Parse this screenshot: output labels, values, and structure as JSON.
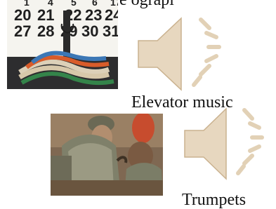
{
  "slide": {
    "top_text": "e ograpl",
    "items": [
      {
        "label": "Elevator music",
        "sound_icon": "speaker-sound-icon"
      },
      {
        "label": "Trumpets",
        "sound_icon": "speaker-sound-icon"
      }
    ],
    "calendar_numbers": {
      "row1": [
        "20",
        "21",
        "22",
        "23",
        "24"
      ],
      "row2": [
        "27",
        "28",
        "29",
        "30",
        "31"
      ]
    },
    "speaker_color": "#e7d7bf",
    "speaker_outline": "#cab28f"
  }
}
